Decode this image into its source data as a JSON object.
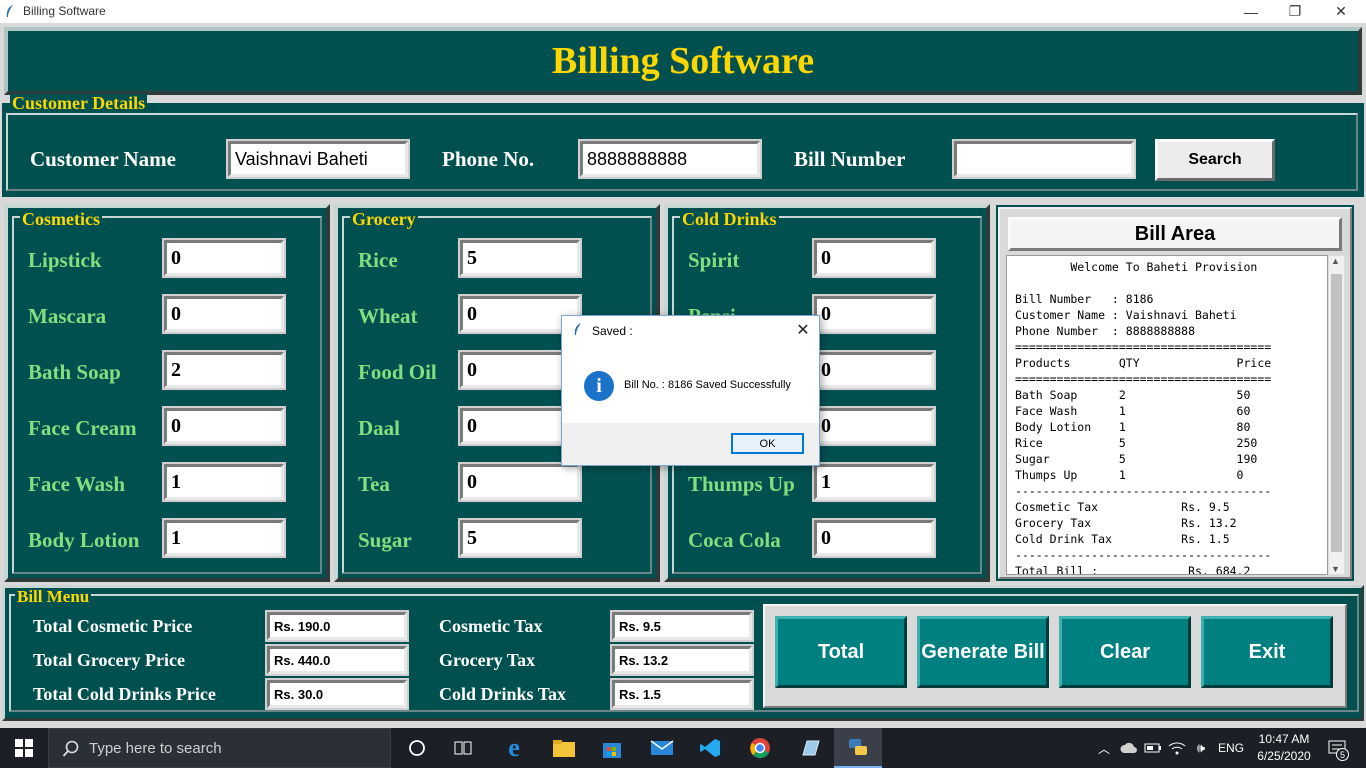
{
  "window": {
    "title": "Billing Software"
  },
  "header": {
    "title": "Billing Software"
  },
  "customer": {
    "legend": "Customer Details",
    "name_label": "Customer Name",
    "name_value": "Vaishnavi Baheti",
    "phone_label": "Phone No.",
    "phone_value": "8888888888",
    "bill_label": "Bill Number",
    "bill_value": "",
    "search_label": "Search"
  },
  "cosmetics": {
    "legend": "Cosmetics",
    "items": [
      {
        "label": "Lipstick",
        "qty": "0"
      },
      {
        "label": "Mascara",
        "qty": "0"
      },
      {
        "label": "Bath Soap",
        "qty": "2"
      },
      {
        "label": "Face Cream",
        "qty": "0"
      },
      {
        "label": "Face Wash",
        "qty": "1"
      },
      {
        "label": "Body Lotion",
        "qty": "1"
      }
    ]
  },
  "grocery": {
    "legend": "Grocery",
    "items": [
      {
        "label": "Rice",
        "qty": "5"
      },
      {
        "label": "Wheat",
        "qty": "0"
      },
      {
        "label": "Food Oil",
        "qty": "0"
      },
      {
        "label": "Daal",
        "qty": "0"
      },
      {
        "label": "Tea",
        "qty": "0"
      },
      {
        "label": "Sugar",
        "qty": "5"
      }
    ]
  },
  "colddrinks": {
    "legend": "Cold Drinks",
    "items": [
      {
        "label": "Spirit",
        "qty": "0"
      },
      {
        "label": "Pepsi",
        "qty": "0"
      },
      {
        "label": "",
        "qty": "0"
      },
      {
        "label": "",
        "qty": "0"
      },
      {
        "label": "Thumps Up",
        "qty": "1"
      },
      {
        "label": "Coca Cola",
        "qty": "0"
      }
    ]
  },
  "billarea": {
    "title": "Bill Area",
    "text": "        Welcome To Baheti Provision\n\nBill Number   : 8186\nCustomer Name : Vaishnavi Baheti\nPhone Number  : 8888888888\n=====================================\nProducts       QTY              Price\n=====================================\nBath Soap      2                50\nFace Wash      1                60\nBody Lotion    1                80\nRice           5                250\nSugar          5                190\nThumps Up      1                0\n-------------------------------------\nCosmetic Tax            Rs. 9.5\nGrocery Tax             Rs. 13.2\nCold Drink Tax          Rs. 1.5\n-------------------------------------\nTotal Bill :             Rs. 684.2"
  },
  "billmenu": {
    "legend": "Bill Menu",
    "total_cosmetic_label": "Total Cosmetic Price",
    "total_cosmetic_value": "Rs. 190.0",
    "total_grocery_label": "Total Grocery Price",
    "total_grocery_value": "Rs. 440.0",
    "total_cold_label": "Total Cold Drinks Price",
    "total_cold_value": "Rs. 30.0",
    "cosmetic_tax_label": "Cosmetic Tax",
    "cosmetic_tax_value": "Rs. 9.5",
    "grocery_tax_label": "Grocery Tax",
    "grocery_tax_value": "Rs. 13.2",
    "cold_tax_label": "Cold Drinks Tax",
    "cold_tax_value": "Rs. 1.5",
    "buttons": {
      "total": "Total",
      "generate": "Generate Bill",
      "clear": "Clear",
      "exit": "Exit"
    }
  },
  "dialog": {
    "title": "Saved :",
    "message": "Bill No. : 8186 Saved Successfully",
    "ok": "OK"
  },
  "taskbar": {
    "search_placeholder": "Type here to search",
    "lang": "ENG",
    "time": "10:47 AM",
    "date": "6/25/2020",
    "notif_count": "5"
  },
  "colors": {
    "teal": "#005050",
    "gold": "#ffd700",
    "green_label": "#7ee07e",
    "button_teal": "#008080"
  }
}
